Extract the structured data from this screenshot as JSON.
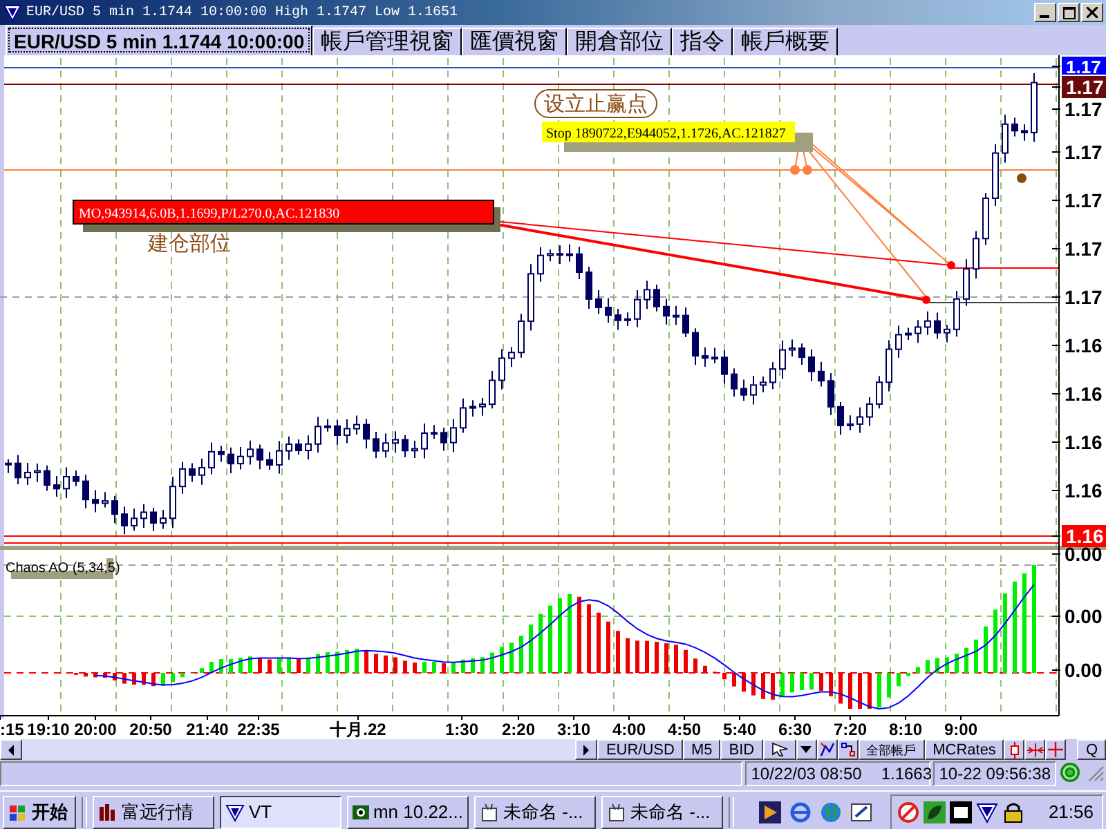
{
  "window": {
    "title": "EUR/USD 5 min 1.1744 10:00:00 High 1.1747 Low 1.1651"
  },
  "tabs": [
    {
      "label": "EUR/USD 5 min 1.1744 10:00:00",
      "selected": true
    },
    {
      "label": "帳戶管理視窗",
      "selected": false
    },
    {
      "label": "匯價視窗",
      "selected": false
    },
    {
      "label": "開倉部位",
      "selected": false
    },
    {
      "label": "指令",
      "selected": false
    },
    {
      "label": "帳戶概要",
      "selected": false
    }
  ],
  "chart": {
    "annotations": [
      {
        "kind": "callout",
        "text": "设立止赢点"
      },
      {
        "kind": "stop_order",
        "text": "Stop 1890722,E944052,1.1726,AC.121827"
      },
      {
        "kind": "market_order",
        "text": "MO,943914,6.0B,1.1699,P/L270.0,AC.121830"
      },
      {
        "kind": "label",
        "text": "建仓部位"
      }
    ],
    "price_labels": [
      {
        "text": "1.17",
        "kind": "current"
      },
      {
        "text": "1.17",
        "kind": "order"
      },
      {
        "text": "1.17",
        "kind": "plain"
      },
      {
        "text": "1.17",
        "kind": "plain"
      },
      {
        "text": "1.17",
        "kind": "plain"
      },
      {
        "text": "1.17",
        "kind": "plain"
      },
      {
        "text": "1.17",
        "kind": "plain"
      },
      {
        "text": "1.16",
        "kind": "plain"
      },
      {
        "text": "1.16",
        "kind": "plain"
      },
      {
        "text": "1.16",
        "kind": "plain"
      },
      {
        "text": "1.16",
        "kind": "plain"
      },
      {
        "text": "1.16",
        "kind": "low"
      }
    ],
    "indicator": {
      "title": "Chaos AO (5,34,5)",
      "axis_labels": [
        "0.00",
        "0.00",
        "0.00"
      ]
    },
    "time_labels": [
      ":15",
      "19:10",
      "20:00",
      "20:50",
      "21:40",
      "22:35",
      "十月.22",
      "1:30",
      "2:20",
      "3:10",
      "4:00",
      "4:50",
      "5:40",
      "6:30",
      "7:20",
      "8:10",
      "9:00"
    ]
  },
  "toolbar": {
    "buttons": [
      {
        "label": "EUR/USD",
        "kind": "text"
      },
      {
        "label": "M5",
        "kind": "text"
      },
      {
        "label": "BID",
        "kind": "text"
      },
      {
        "label": "全部帳戶",
        "kind": "small"
      },
      {
        "label": "MCRates",
        "kind": "text"
      },
      {
        "label": "Q",
        "kind": "text"
      }
    ]
  },
  "status_bar": {
    "date_time": "10/22/03 08:50",
    "price": "1.1663",
    "clock": "10-22 09:56:38"
  },
  "taskbar": {
    "start": "开始",
    "tasks": [
      {
        "label": "富远行情",
        "selected": false
      },
      {
        "label": "VT",
        "selected": true
      },
      {
        "label": "mn 10.22...",
        "selected": false
      },
      {
        "label": "未命名 -...",
        "selected": false
      },
      {
        "label": "未命名 -...",
        "selected": false
      }
    ],
    "clock": "21:56"
  }
}
